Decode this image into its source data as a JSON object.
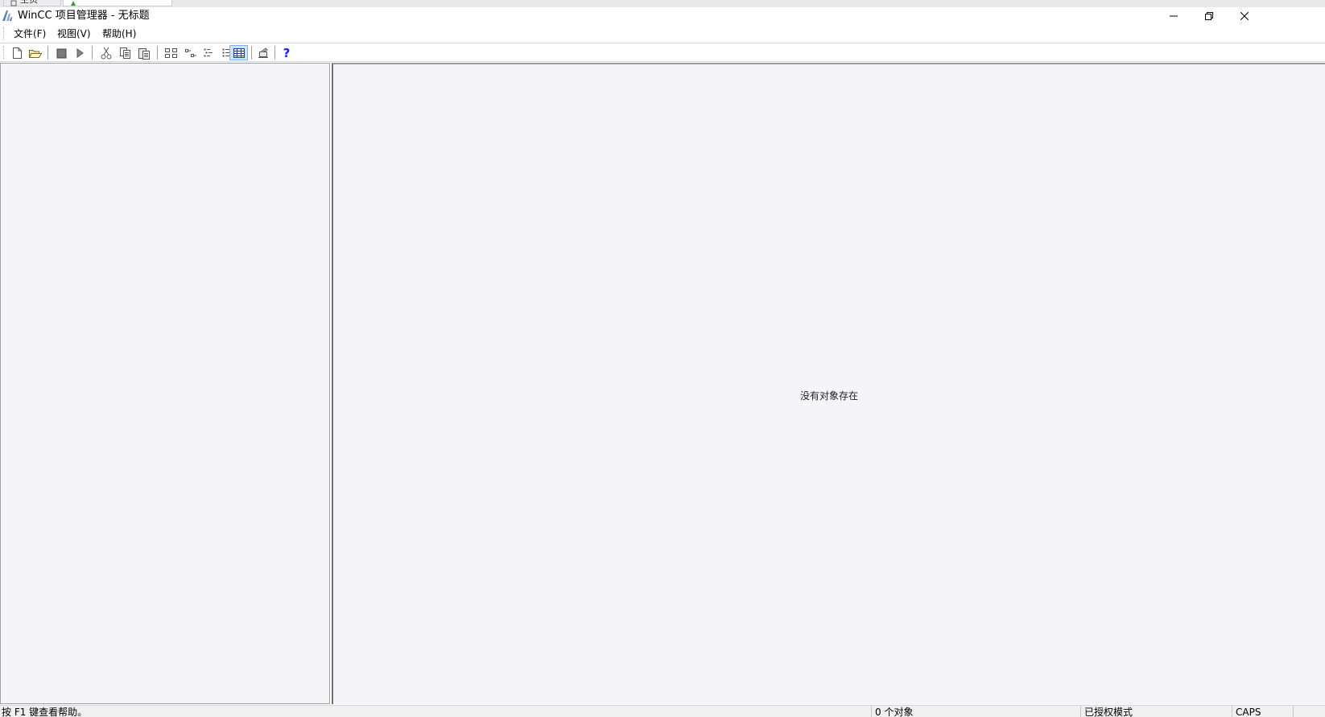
{
  "tabs": [
    {
      "label": "主页"
    },
    {
      "label": ""
    }
  ],
  "window": {
    "title": "WinCC 项目管理器 - 无标题"
  },
  "menu": {
    "items": [
      {
        "label": "文件(F)"
      },
      {
        "label": "视图(V)"
      },
      {
        "label": "帮助(H)"
      }
    ]
  },
  "toolbar": {
    "buttons": [
      {
        "icon": "new-file-icon"
      },
      {
        "icon": "open-folder-icon"
      },
      {
        "icon": "stop-icon"
      },
      {
        "icon": "run-icon"
      },
      {
        "icon": "cut-icon"
      },
      {
        "icon": "copy-icon"
      },
      {
        "icon": "paste-icon"
      },
      {
        "icon": "large-icons-view-icon"
      },
      {
        "icon": "small-icons-view-icon"
      },
      {
        "icon": "list-view-icon"
      },
      {
        "icon": "details-view-icon"
      },
      {
        "icon": "table-view-icon",
        "pressed": true
      },
      {
        "icon": "properties-icon"
      },
      {
        "icon": "help-icon"
      }
    ]
  },
  "main": {
    "empty_message": "没有对象存在"
  },
  "statusbar": {
    "help_hint": "按 F1 键查看帮助。",
    "object_count": "0 个对象",
    "license_mode": "已授权模式",
    "caps": "CAPS",
    "extra": ""
  },
  "colors": {
    "pane_background": "#f5f5f9",
    "pressed_button": "#cce4f7",
    "help_icon": "#1a1aff"
  }
}
